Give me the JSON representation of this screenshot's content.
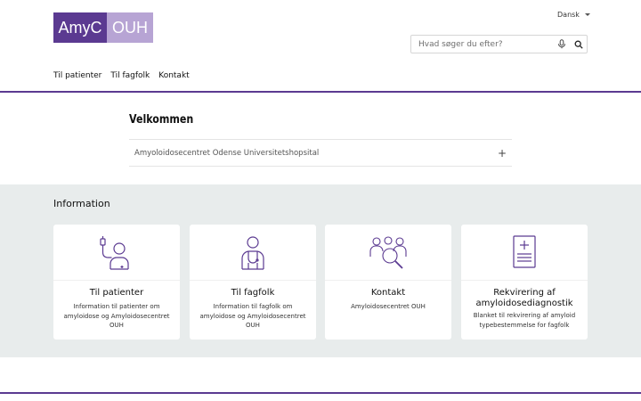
{
  "brand": {
    "logo_left": "AmyC",
    "logo_right": "OUH",
    "accent": "#5b3a91",
    "accent_light": "#b7a4d4"
  },
  "header": {
    "language": "Dansk",
    "search_placeholder": "Hvad søger du efter?"
  },
  "nav": {
    "items": [
      "Til patienter",
      "Til fagfolk",
      "Kontakt"
    ]
  },
  "welcome": {
    "title": "Velkommen",
    "accordion_label": "Amyoloidosecentret Odense Universitetshopsital",
    "accordion_icon": "+"
  },
  "info": {
    "title": "Information",
    "cards": [
      {
        "icon": "patient-iv-icon",
        "title": "Til patienter",
        "desc": "Information til patienter om amyloidose og Amyloidosecentret OUH"
      },
      {
        "icon": "doctor-icon",
        "title": "Til fagfolk",
        "desc": "Information til fagfolk om amyloidose og Amyloidosecentret OUH"
      },
      {
        "icon": "group-search-icon",
        "title": "Kontakt",
        "desc": "Amyloidosecentret OUH"
      },
      {
        "icon": "medical-document-icon",
        "title": "Rekvirering af amyloidosediagnostik",
        "desc": "Blanket til rekvirering af amyloid typebestemmelse for fagfolk"
      }
    ]
  }
}
